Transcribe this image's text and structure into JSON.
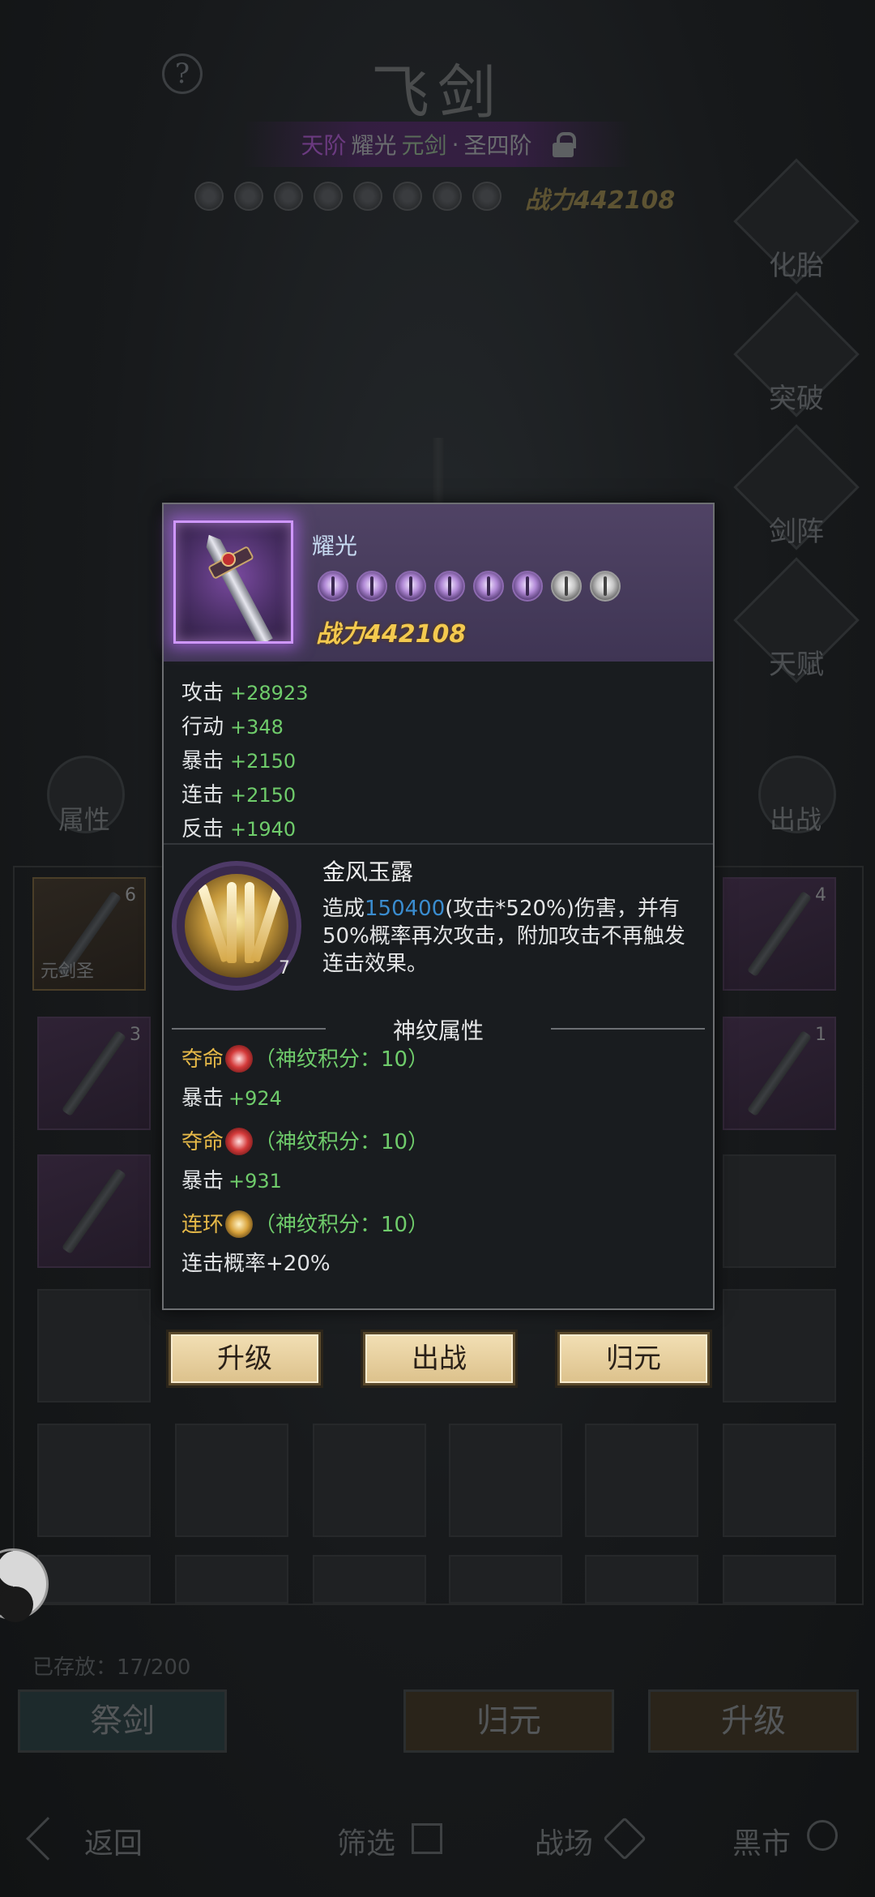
{
  "header": {
    "title": "飞剑",
    "help_icon": "question-icon",
    "rank": {
      "tier": "天阶",
      "name": "耀光",
      "class": "元剑",
      "sep": "·",
      "stage": "圣四阶"
    },
    "power": "战力442108"
  },
  "side_menu": [
    {
      "label": "化胎"
    },
    {
      "label": "突破"
    },
    {
      "label": "剑阵"
    },
    {
      "label": "天赋"
    }
  ],
  "left_button": "属性",
  "right_button": "出战",
  "inventory": {
    "stored": "已存放：17/200",
    "slot_counts": [
      "6",
      "4",
      "3",
      "1"
    ],
    "slot_tag": "元剑",
    "slot_tag2": "圣"
  },
  "bottom_buttons": {
    "sacrifice": "祭剑",
    "return": "归元",
    "upgrade": "升级"
  },
  "nav": {
    "back": "返回",
    "filter": "筛选",
    "battle": "战场",
    "market": "黑市"
  },
  "popup": {
    "item_name": "耀光",
    "power": "战力442108",
    "stars": 8,
    "stats": [
      {
        "label": "攻击",
        "value": "+28923"
      },
      {
        "label": "行动",
        "value": "+348"
      },
      {
        "label": "暴击",
        "value": "+2150"
      },
      {
        "label": "连击",
        "value": "+2150"
      },
      {
        "label": "反击",
        "value": "+1940"
      }
    ],
    "skill": {
      "name": "金风玉露",
      "level": "7",
      "desc_pre": "造成",
      "desc_num": "150400",
      "desc_post": "(攻击*520%)伤害，并有50%概率再次攻击，附加攻击不再触发连击效果。"
    },
    "rune_title": "神纹属性",
    "runes": [
      {
        "name": "夺命",
        "score": "（神纹积分：10）",
        "stat": "暴击",
        "value": "+924"
      },
      {
        "name": "夺命",
        "score": "（神纹积分：10）",
        "stat": "暴击",
        "value": "+931"
      },
      {
        "name": "连环",
        "score": "（神纹积分：10）",
        "stat": "连击概率+20%",
        "value": ""
      }
    ],
    "actions": {
      "upgrade": "升级",
      "deploy": "出战",
      "return": "归元"
    }
  },
  "colors": {
    "accent_purple": "#cf97ff",
    "power_gold": "#f3c94f",
    "stat_green": "#6fcc6b",
    "skill_blue": "#3a8ccf"
  }
}
